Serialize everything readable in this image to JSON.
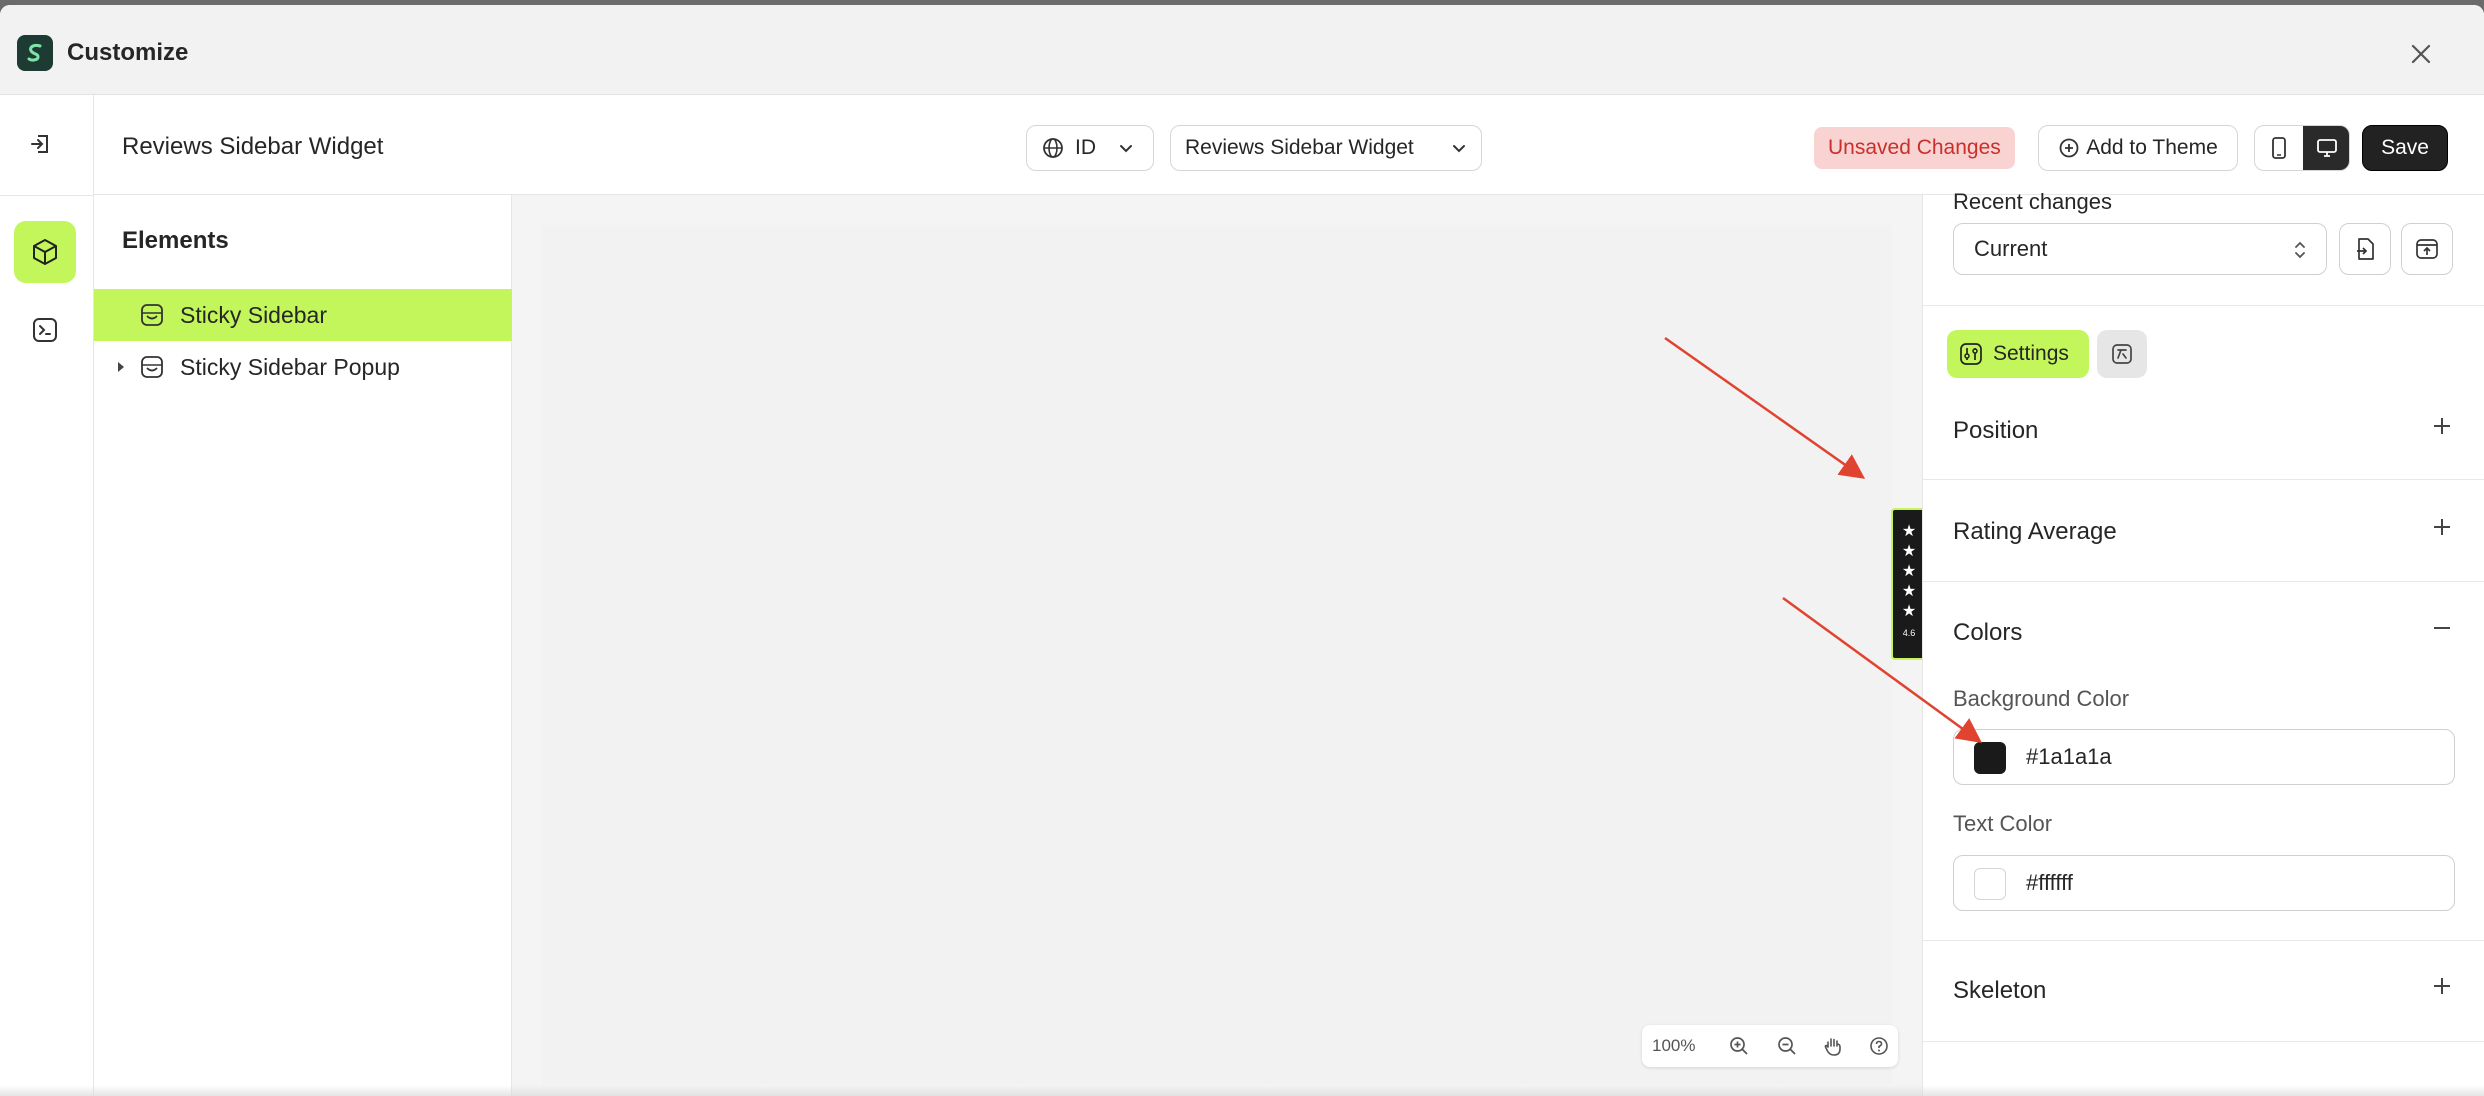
{
  "window": {
    "title": "Customize",
    "close_icon": "close-icon"
  },
  "header": {
    "page_title": "Reviews Sidebar Widget",
    "language": {
      "value": "ID",
      "icon": "globe-icon"
    },
    "template_select": {
      "value": "Reviews Sidebar Widget"
    },
    "unsaved_badge": "Unsaved Changes",
    "add_to_theme": "Add to Theme",
    "save": "Save"
  },
  "elements_panel": {
    "title": "Elements",
    "items": [
      {
        "label": "Sticky Sidebar",
        "selected": true
      },
      {
        "label": "Sticky Sidebar Popup",
        "selected": false
      }
    ]
  },
  "canvas": {
    "widget": {
      "stars": [
        "★",
        "★",
        "★",
        "★",
        "★"
      ],
      "average": "4.6"
    },
    "zoom": "100%"
  },
  "settings_panel": {
    "recent_changes_label": "Recent changes",
    "recent_changes_value": "Current",
    "tabs": {
      "settings": "Settings"
    },
    "sections": {
      "position": "Position",
      "rating_average": "Rating Average",
      "colors": "Colors",
      "skeleton": "Skeleton"
    },
    "colors": {
      "background_label": "Background Color",
      "background_value": "#1a1a1a",
      "text_label": "Text Color",
      "text_value": "#ffffff"
    }
  },
  "theme": {
    "accent": "#c2f65a",
    "annotation_arrow": "#e0432f",
    "danger_text": "#c9302c",
    "danger_bg": "#f8d3d2"
  }
}
